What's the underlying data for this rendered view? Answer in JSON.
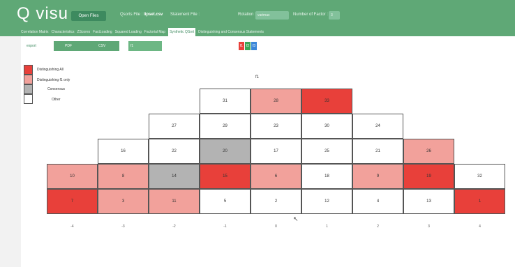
{
  "app": {
    "title": "Q visu"
  },
  "header": {
    "open_files": "Open Files",
    "qsorts_label": "Qsorts File :",
    "qsorts_value": "lipset.csv",
    "statement_label": "Statement File :",
    "rotation_label": "Rotation :",
    "rotation_value": "varimax",
    "factors_label": "Number of Factor :",
    "factors_value": "3"
  },
  "tabs": [
    "Correlation Matrix",
    "Characteristics",
    "ZScores",
    "FactLoading",
    "Squared Loading",
    "Factorial Map",
    "Synthetic QSort",
    "Distinguishing and Consensus Statements"
  ],
  "active_tab": 6,
  "toolbar": {
    "export": "export",
    "pdf": "PDF",
    "csv": "CSV",
    "field": "f1"
  },
  "factor_chips": [
    {
      "label": "f1",
      "color": "#e8403a"
    },
    {
      "label": "f2",
      "color": "#3aa655"
    },
    {
      "label": "f3",
      "color": "#3a86d8"
    }
  ],
  "legend": [
    {
      "label": "Distinguishing All",
      "color": "#e8403a"
    },
    {
      "label": "Distinguishing f1 only",
      "color": "#f2a19b"
    },
    {
      "label": "Consensus",
      "color": "#b3b3b3"
    },
    {
      "label": "Other",
      "color": "#ffffff"
    }
  ],
  "colors": {
    "all": "#e8403a",
    "only": "#f2a19b",
    "consensus": "#b3b3b3",
    "other": "#ffffff"
  },
  "chart_data": {
    "type": "table",
    "title": "f1",
    "x_ticks": [
      "-4",
      "-3",
      "-2",
      "-1",
      "0",
      "1",
      "2",
      "3",
      "4"
    ],
    "columns": [
      {
        "x": "-4",
        "cells": [
          {
            "v": "7",
            "k": "all"
          },
          {
            "v": "10",
            "k": "only"
          }
        ]
      },
      {
        "x": "-3",
        "cells": [
          {
            "v": "3",
            "k": "only"
          },
          {
            "v": "8",
            "k": "only"
          },
          {
            "v": "16",
            "k": "other"
          }
        ]
      },
      {
        "x": "-2",
        "cells": [
          {
            "v": "11",
            "k": "only"
          },
          {
            "v": "14",
            "k": "consensus"
          },
          {
            "v": "22",
            "k": "other"
          },
          {
            "v": "27",
            "k": "other"
          }
        ]
      },
      {
        "x": "-1",
        "cells": [
          {
            "v": "5",
            "k": "other"
          },
          {
            "v": "15",
            "k": "all"
          },
          {
            "v": "20",
            "k": "consensus"
          },
          {
            "v": "29",
            "k": "other"
          },
          {
            "v": "31",
            "k": "other"
          }
        ]
      },
      {
        "x": "0",
        "cells": [
          {
            "v": "2",
            "k": "other"
          },
          {
            "v": "6",
            "k": "only"
          },
          {
            "v": "17",
            "k": "other"
          },
          {
            "v": "23",
            "k": "other"
          },
          {
            "v": "28",
            "k": "only"
          }
        ]
      },
      {
        "x": "1",
        "cells": [
          {
            "v": "12",
            "k": "other"
          },
          {
            "v": "18",
            "k": "other"
          },
          {
            "v": "25",
            "k": "other"
          },
          {
            "v": "30",
            "k": "other"
          },
          {
            "v": "33",
            "k": "all"
          }
        ]
      },
      {
        "x": "2",
        "cells": [
          {
            "v": "4",
            "k": "other"
          },
          {
            "v": "9",
            "k": "only"
          },
          {
            "v": "21",
            "k": "other"
          },
          {
            "v": "24",
            "k": "other"
          }
        ]
      },
      {
        "x": "3",
        "cells": [
          {
            "v": "13",
            "k": "other"
          },
          {
            "v": "19",
            "k": "all"
          },
          {
            "v": "26",
            "k": "only"
          }
        ]
      },
      {
        "x": "4",
        "cells": [
          {
            "v": "1",
            "k": "all"
          },
          {
            "v": "32",
            "k": "other"
          }
        ]
      }
    ]
  }
}
